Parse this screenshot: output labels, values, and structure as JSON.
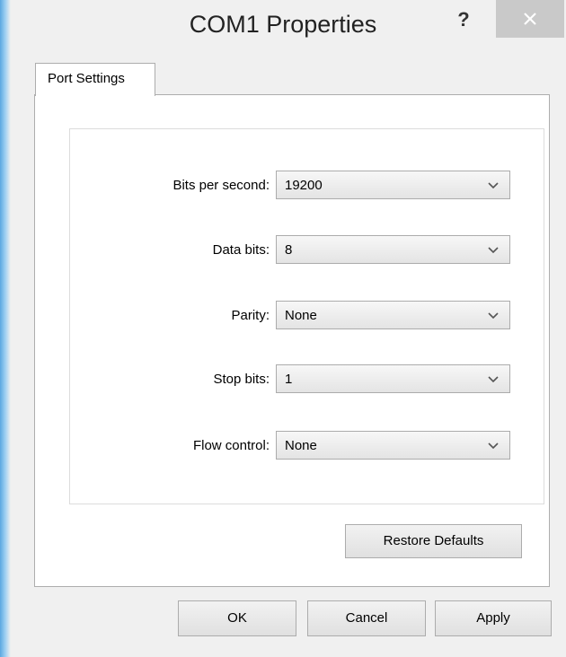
{
  "window": {
    "title": "COM1 Properties",
    "help_label": "?",
    "close_icon": "close-icon"
  },
  "tabs": [
    {
      "label": "Port Settings",
      "active": true
    }
  ],
  "port_settings": {
    "fields": [
      {
        "label": "Bits per second:",
        "value": "19200"
      },
      {
        "label": "Data bits:",
        "value": "8"
      },
      {
        "label": "Parity:",
        "value": "None"
      },
      {
        "label": "Stop bits:",
        "value": "1"
      },
      {
        "label": "Flow control:",
        "value": "None"
      }
    ],
    "restore_defaults_label": "Restore Defaults"
  },
  "footer": {
    "ok_label": "OK",
    "cancel_label": "Cancel",
    "apply_label": "Apply"
  },
  "colors": {
    "window_bg": "#f0f0f0",
    "panel_bg": "#ffffff",
    "close_button_bg": "#c9c9c9",
    "border": "#adadad"
  }
}
